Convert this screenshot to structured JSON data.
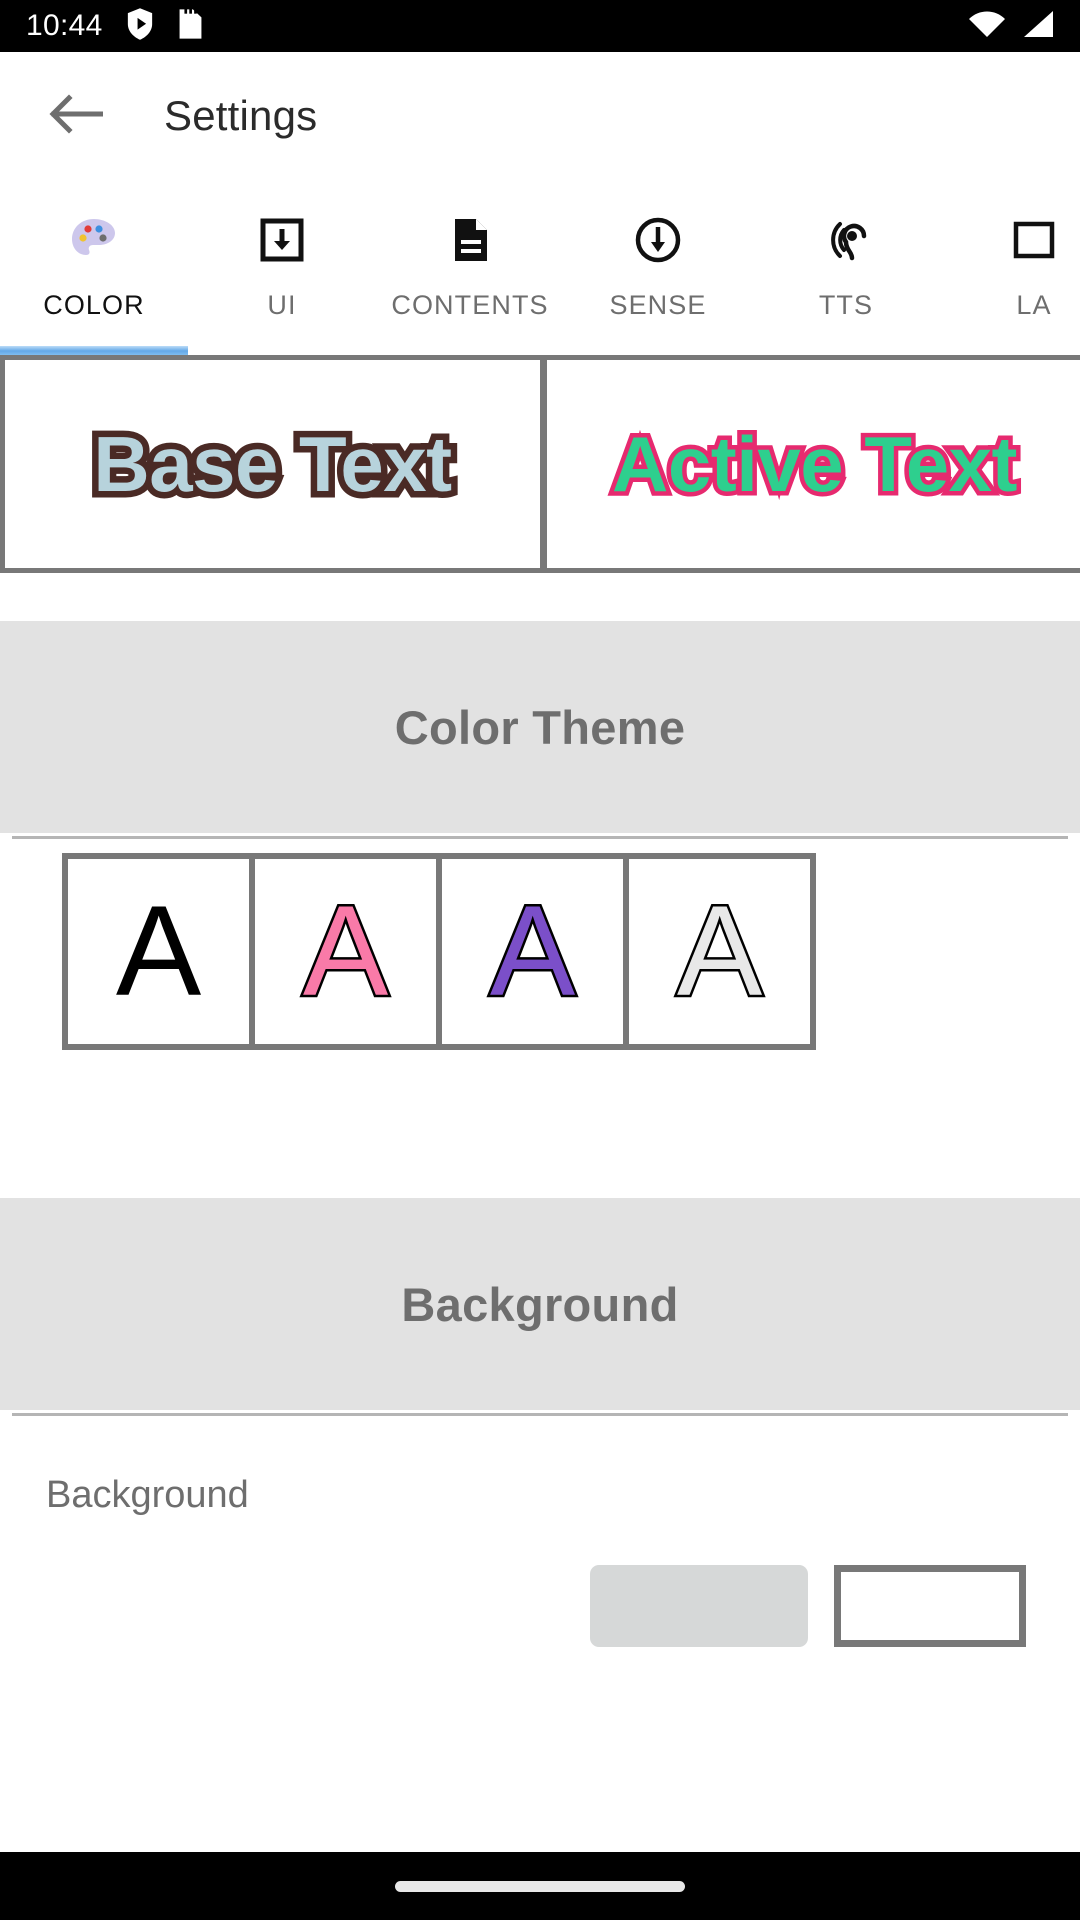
{
  "status_bar": {
    "time": "10:44",
    "left_icons": [
      "shield-play-icon",
      "sd-card-icon"
    ],
    "right_icons": [
      "wifi-icon",
      "cellular-signal-icon"
    ],
    "background_color": "#000000"
  },
  "app_bar": {
    "back_icon": "arrow-back-icon",
    "title": "Settings"
  },
  "tabs": {
    "active_index": 0,
    "indicator_color": "#63a8e8",
    "items": [
      {
        "label": "COLOR",
        "icon": "palette-icon"
      },
      {
        "label": "UI",
        "icon": "box-download-icon"
      },
      {
        "label": "CONTENTS",
        "icon": "document-lines-icon"
      },
      {
        "label": "SENSE",
        "icon": "circle-arrow-down-icon"
      },
      {
        "label": "TTS",
        "icon": "hearing-ear-icon"
      },
      {
        "label": "LA",
        "icon": "layout-icon"
      }
    ]
  },
  "preview": {
    "border_color": "#787878",
    "cards": [
      {
        "text": "Base Text",
        "fill_color": "#b7d3dc",
        "outline_color": "#4a2a25",
        "name": "base-text-preview"
      },
      {
        "text": "Active Text",
        "fill_color": "#2ecf8e",
        "outline_color": "#e62a6f",
        "name": "active-text-preview"
      }
    ]
  },
  "color_theme": {
    "header": "Color Theme",
    "header_bg": "#e2e2e2",
    "header_text_color": "#6e6e6e",
    "swatch_border_color": "#787878",
    "swatches": [
      {
        "letter": "A",
        "fill_color": "#000000",
        "outline_color": "#000000",
        "name": "theme-swatch-black"
      },
      {
        "letter": "A",
        "fill_color": "#f97aa8",
        "outline_color": "#000000",
        "name": "theme-swatch-pink"
      },
      {
        "letter": "A",
        "fill_color": "#7b4fc9",
        "outline_color": "#000000",
        "name": "theme-swatch-purple"
      },
      {
        "letter": "A",
        "fill_color": "#e8e8e8",
        "outline_color": "#000000",
        "name": "theme-swatch-white"
      }
    ]
  },
  "background_section": {
    "header": "Background",
    "header_bg": "#e2e2e2",
    "header_text_color": "#6e6e6e",
    "row_label": "Background",
    "pill_color": "#d6d8d8",
    "box_border_color": "#787878"
  },
  "nav_bar": {
    "handle_label": "home-gesture-handle",
    "background_color": "#000000"
  }
}
